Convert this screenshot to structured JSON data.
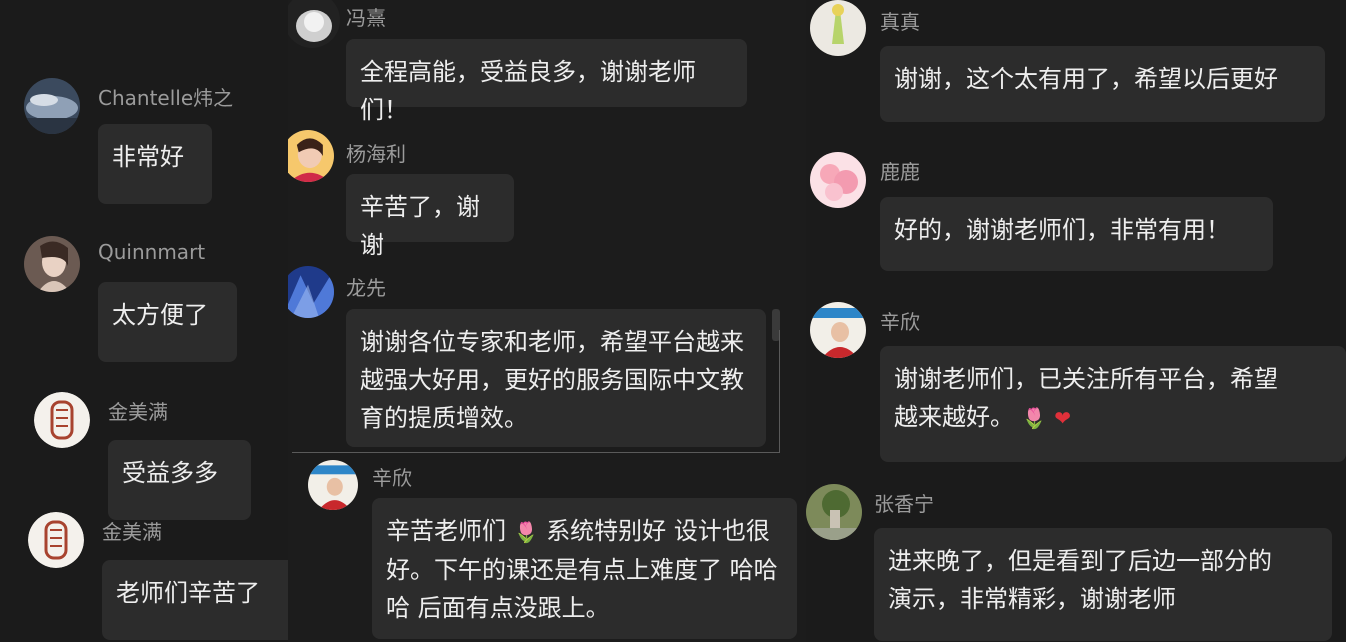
{
  "messages": [
    {
      "name": "Chantelle炜之",
      "text": "非常好"
    },
    {
      "name": "Quinnmart",
      "text": "太方便了"
    },
    {
      "name": "金美满",
      "text": "受益多多"
    },
    {
      "name": "金美满",
      "text": "老师们辛苦了"
    },
    {
      "name": "冯熹",
      "text": "全程高能，受益良多，谢谢老师们！"
    },
    {
      "name": "杨海利",
      "text": "辛苦了，谢谢"
    },
    {
      "name": "龙先",
      "lines": [
        "谢谢各位专家和老师，希望平台越来",
        "越强大好用，更好的服务国际中文教",
        "育的提质增效。"
      ]
    },
    {
      "name": "辛欣",
      "lines": [
        "辛苦老师们",
        "系统特别好 设计也很",
        "好。下午的课还是有点上难度了 哈哈",
        "哈 后面有点没跟上。"
      ],
      "emoji": "rose-emoji"
    },
    {
      "name": "真真",
      "text": "谢谢，这个太有用了，希望以后更好"
    },
    {
      "name": "鹿鹿",
      "text": "好的，谢谢老师们，非常有用！"
    },
    {
      "name": "辛欣",
      "lines": [
        "谢谢老师们，已关注所有平台，希望",
        "越来越好。"
      ],
      "emojis": [
        "rose-emoji",
        "heart-emoji"
      ]
    },
    {
      "name": "张香宁",
      "lines": [
        "进来晚了，但是看到了后边一部分的",
        "演示，非常精彩，谢谢老师"
      ]
    }
  ],
  "colors": {
    "background": "#1a1a1a",
    "bubble": "#2c2c2c",
    "name_text": "#9b9b9b",
    "message_text": "#eeeeee",
    "heart": "#e0303a"
  }
}
